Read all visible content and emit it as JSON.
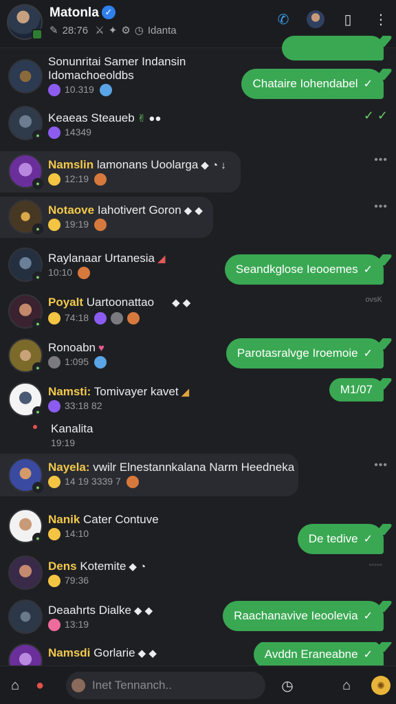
{
  "header": {
    "title": "Matonla",
    "subtitle_items": [
      "28:76",
      "Idanta"
    ],
    "icons": [
      "phone-call-icon",
      "profile-avatar-icon",
      "phone-device-icon",
      "more-vertical-icon"
    ]
  },
  "chats": [
    {
      "name": "Sonunritai Samer Indansin",
      "name2": "Idomachoeoldbs",
      "meta": "10.319",
      "outgoing": "",
      "right_marker": "dots"
    },
    {
      "name": "Keaeas Steaueb",
      "name2": "",
      "meta": "14349",
      "outgoing": "Chataire Iohendabel",
      "right_marker": "ticks"
    },
    {
      "name_hl": "Namslin",
      "name": "lamonans Uoolarga",
      "meta": "12:19",
      "outgoing": "",
      "right_marker": "dots"
    },
    {
      "name_hl": "Notaove",
      "name": "Iahotivert Goron",
      "meta": "19:19",
      "outgoing": "",
      "right_marker": "dots"
    },
    {
      "name": "Raylanaar Urtanesia",
      "name2": "",
      "meta": "10:10",
      "outgoing": "Seandkglose Ieooemes",
      "right_marker": ""
    },
    {
      "name_hl": "Poyalt",
      "name": "Uartoonattao",
      "meta": "74:18",
      "outgoing": "",
      "right_marker": "small"
    },
    {
      "name": "Ronoabn",
      "name2": "",
      "meta": "1:095",
      "outgoing": "Parotasralvge Iroemoie",
      "right_marker": ""
    },
    {
      "name_hl": "Namsti:",
      "name": "Tomivayer kavet",
      "meta": "33:18  82",
      "outgoing": "M1/07",
      "right_marker": ""
    },
    {
      "name": "Kanalita",
      "name2": "",
      "meta": "19:19",
      "outgoing": "",
      "right_marker": ""
    },
    {
      "name_hl": "Nayela:",
      "name": "vwilr Elnestannkalana Narm Heedneka",
      "meta": "14   19 3339   7",
      "outgoing": "",
      "right_marker": "dots"
    },
    {
      "name_hl": "Nanik",
      "name": "Cater  Contuve",
      "meta": "14:10",
      "outgoing": "De tedive",
      "right_marker": ""
    },
    {
      "name_hl": "Dens",
      "name": "Kotemite",
      "meta": "79:36",
      "outgoing": "",
      "right_marker": "small"
    },
    {
      "name": "Deaahrts Dialke",
      "name2": "",
      "meta": "13:19",
      "outgoing": "Raachanavive Ieoolevia",
      "right_marker": ""
    },
    {
      "name_hl": "Namsdi",
      "name": "Gorlarie",
      "meta": "",
      "outgoing": "Avddn Eraneabne",
      "right_marker": ""
    }
  ],
  "top_partial_bubble": "",
  "small_mark_text": "ovsK",
  "bottom": {
    "search_placeholder": "Inet Tennanch..",
    "icons": [
      "home-icon",
      "record-icon",
      "timer-icon",
      "house-outline-icon",
      "sticker-coin-icon"
    ]
  },
  "colors": {
    "accent_green": "#3aa853",
    "highlight_yellow": "#f2c94c",
    "verified_blue": "#2f80ed"
  }
}
